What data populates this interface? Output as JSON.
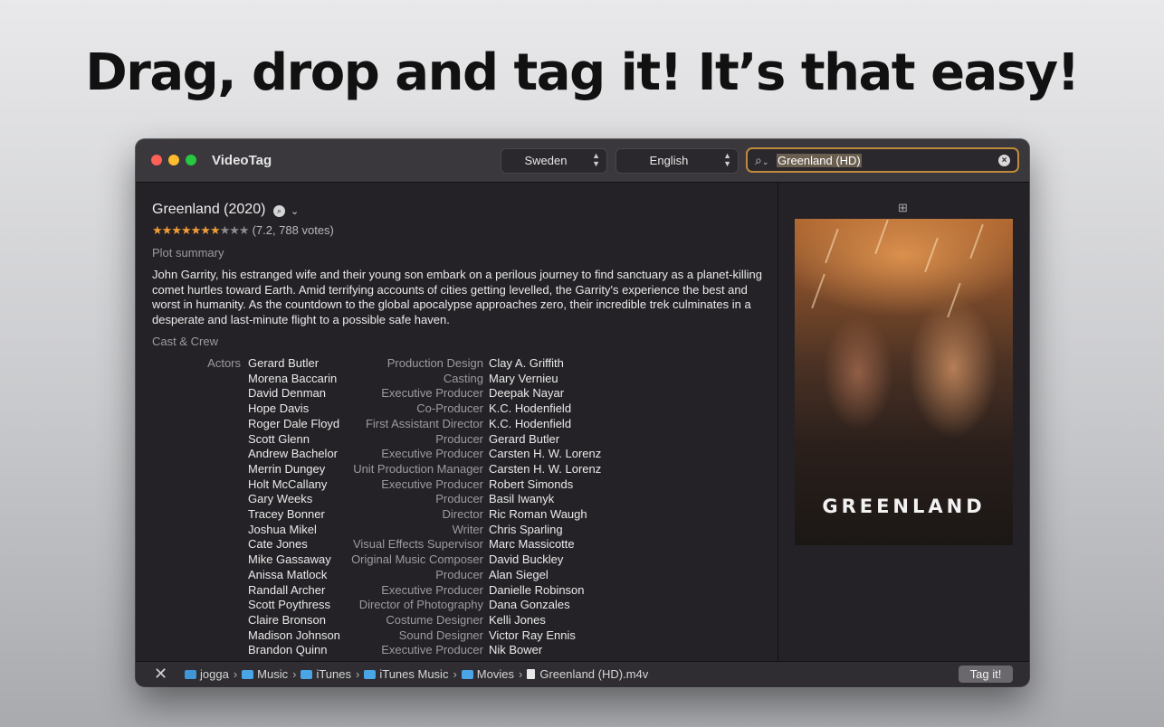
{
  "headline": "Drag, drop and tag it! It’s that easy!",
  "window": {
    "app_title": "VideoTag",
    "country_select": "Sweden",
    "language_select": "English",
    "search_value": "Greenland (HD)"
  },
  "movie": {
    "title": "Greenland (2020)",
    "rating_stars": 7,
    "rating_max": 10,
    "rating_text": "(7.2, 788 votes)",
    "plot_label": "Plot summary",
    "plot": "John Garrity, his estranged wife and their young son embark on a perilous journey to find sanctuary as a planet-killing comet hurtles toward Earth. Amid terrifying accounts of cities getting levelled, the Garrity's experience the best and worst in humanity. As the countdown to the global apocalypse approaches zero, their incredible trek culminates in a desperate and last-minute flight to a possible safe haven.",
    "cast_label": "Cast & Crew",
    "actors_label": "Actors",
    "actors": [
      "Gerard Butler",
      "Morena Baccarin",
      "David Denman",
      "Hope Davis",
      "Roger Dale Floyd",
      "Scott Glenn",
      "Andrew Bachelor",
      "Merrin Dungey",
      "Holt McCallany",
      "Gary Weeks",
      "Tracey Bonner",
      "Joshua Mikel",
      "Cate Jones",
      "Mike Gassaway",
      "Anissa Matlock",
      "Randall Archer",
      "Scott Poythress",
      "Claire Bronson",
      "Madison Johnson",
      "Brandon Quinn"
    ],
    "crew": [
      {
        "role": "Production Design",
        "name": "Clay A. Griffith"
      },
      {
        "role": "Casting",
        "name": "Mary Vernieu"
      },
      {
        "role": "Executive Producer",
        "name": "Deepak Nayar"
      },
      {
        "role": "Co-Producer",
        "name": "K.C. Hodenfield"
      },
      {
        "role": "First Assistant Director",
        "name": "K.C. Hodenfield"
      },
      {
        "role": "Producer",
        "name": "Gerard Butler"
      },
      {
        "role": "Executive Producer",
        "name": "Carsten H. W. Lorenz"
      },
      {
        "role": "Unit Production Manager",
        "name": "Carsten H. W. Lorenz"
      },
      {
        "role": "Executive Producer",
        "name": "Robert Simonds"
      },
      {
        "role": "Producer",
        "name": "Basil Iwanyk"
      },
      {
        "role": "Director",
        "name": "Ric Roman Waugh"
      },
      {
        "role": "Writer",
        "name": "Chris Sparling"
      },
      {
        "role": "Visual Effects Supervisor",
        "name": "Marc Massicotte"
      },
      {
        "role": "Original Music Composer",
        "name": "David Buckley"
      },
      {
        "role": "Producer",
        "name": "Alan Siegel"
      },
      {
        "role": "Executive Producer",
        "name": "Danielle Robinson"
      },
      {
        "role": "Director of Photography",
        "name": "Dana Gonzales"
      },
      {
        "role": "Costume Designer",
        "name": "Kelli Jones"
      },
      {
        "role": "Sound Designer",
        "name": "Victor Ray Ennis"
      },
      {
        "role": "Executive Producer",
        "name": "Nik Bower"
      }
    ],
    "poster_title": "GREENLAND"
  },
  "path": [
    {
      "label": "jogga",
      "icon": "home-folder-icon"
    },
    {
      "label": "Music",
      "icon": "folder-icon"
    },
    {
      "label": "iTunes",
      "icon": "folder-icon"
    },
    {
      "label": "iTunes Music",
      "icon": "folder-icon"
    },
    {
      "label": "Movies",
      "icon": "folder-icon"
    },
    {
      "label": "Greenland (HD).m4v",
      "icon": "video-file-icon"
    }
  ],
  "tag_button": "Tag it!",
  "colors": {
    "accent": "#bf8a3b",
    "star": "#f09d38",
    "folder": "#4aa5e6"
  }
}
